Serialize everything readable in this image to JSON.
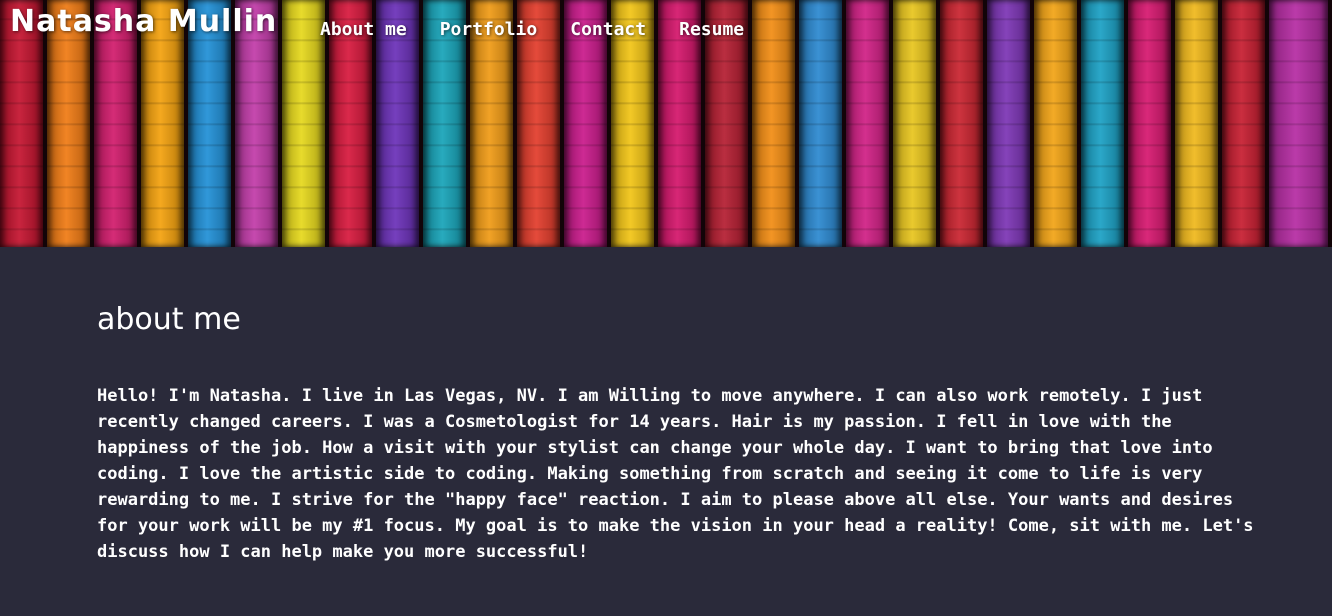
{
  "site": {
    "title": "Natasha Mullin"
  },
  "nav": {
    "items": [
      {
        "label": "About me"
      },
      {
        "label": "Portfolio"
      },
      {
        "label": "Contact"
      },
      {
        "label": "Resume"
      }
    ]
  },
  "hero": {
    "image": "colorful-painted-wood-planks",
    "plank_colors": [
      "#c4122e",
      "#f07a12",
      "#d11a6b",
      "#f4a10c",
      "#1f8fd6",
      "#c13aa8",
      "#e6d81a",
      "#d7173c",
      "#6a2fb8",
      "#16a3b8",
      "#f09a14",
      "#e23b2a",
      "#c9188a",
      "#f2c414",
      "#d4146a",
      "#b41c30",
      "#f28c12",
      "#2a88d0",
      "#d01e84",
      "#e8c51c",
      "#c9222e",
      "#7b33b4",
      "#f2a314",
      "#19a0c4",
      "#d6166e",
      "#f0b81a",
      "#c61c2f",
      "#b52aa2"
    ]
  },
  "about": {
    "heading": "about me",
    "text": "Hello! I'm Natasha. I live in Las Vegas, NV. I am Willing to move anywhere. I can also work remotely. I just recently changed careers. I was a Cosmetologist for 14 years. Hair is my passion. I fell in love with the happiness of the job. How a visit with your stylist can change your whole day. I want to bring that love into coding. I love the artistic side to coding. Making something from scratch and seeing it come to life is very rewarding to me. I strive for the \"happy face\" reaction. I aim to please above all else. Your wants and desires for your work will be my #1 focus. My goal is to make the vision in your head a reality! Come, sit with me. Let's discuss how I can help make you more successful!"
  },
  "colors": {
    "background": "#2a2a3a",
    "text": "#ffffff"
  }
}
